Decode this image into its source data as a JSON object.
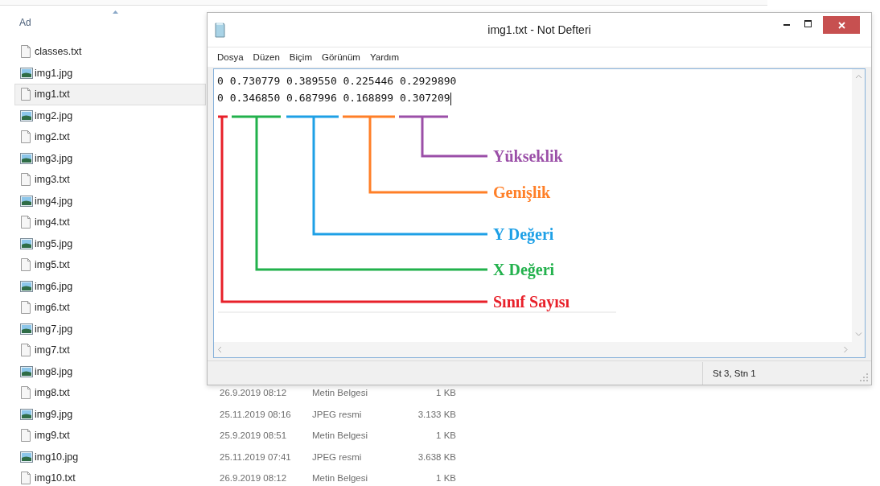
{
  "explorer": {
    "columns": [
      "Ad"
    ],
    "files": [
      {
        "name": "classes.txt",
        "kind": "text",
        "selected": false
      },
      {
        "name": "img1.jpg",
        "kind": "image",
        "selected": false
      },
      {
        "name": "img1.txt",
        "kind": "text",
        "selected": true
      },
      {
        "name": "img2.jpg",
        "kind": "image",
        "selected": false
      },
      {
        "name": "img2.txt",
        "kind": "text",
        "selected": false
      },
      {
        "name": "img3.jpg",
        "kind": "image",
        "selected": false
      },
      {
        "name": "img3.txt",
        "kind": "text",
        "selected": false
      },
      {
        "name": "img4.jpg",
        "kind": "image",
        "selected": false
      },
      {
        "name": "img4.txt",
        "kind": "text",
        "selected": false
      },
      {
        "name": "img5.jpg",
        "kind": "image",
        "selected": false
      },
      {
        "name": "img5.txt",
        "kind": "text",
        "selected": false
      },
      {
        "name": "img6.jpg",
        "kind": "image",
        "selected": false
      },
      {
        "name": "img6.txt",
        "kind": "text",
        "selected": false
      },
      {
        "name": "img7.jpg",
        "kind": "image",
        "selected": false
      },
      {
        "name": "img7.txt",
        "kind": "text",
        "selected": false
      },
      {
        "name": "img8.jpg",
        "kind": "image",
        "selected": false
      },
      {
        "name": "img8.txt",
        "kind": "text",
        "selected": false,
        "date": "26.9.2019 08:12",
        "type": "Metin Belgesi",
        "size": "1 KB"
      },
      {
        "name": "img9.jpg",
        "kind": "image",
        "selected": false,
        "date": "25.11.2019 08:16",
        "type": "JPEG resmi",
        "size": "3.133 KB"
      },
      {
        "name": "img9.txt",
        "kind": "text",
        "selected": false,
        "date": "25.9.2019 08:51",
        "type": "Metin Belgesi",
        "size": "1 KB"
      },
      {
        "name": "img10.jpg",
        "kind": "image",
        "selected": false,
        "date": "25.11.2019 07:41",
        "type": "JPEG resmi",
        "size": "3.638 KB"
      },
      {
        "name": "img10.txt",
        "kind": "text",
        "selected": false,
        "date": "26.9.2019 08:12",
        "type": "Metin Belgesi",
        "size": "1 KB"
      }
    ]
  },
  "notepad": {
    "title": "img1.txt - Not Defteri",
    "menu": [
      "Dosya",
      "Düzen",
      "Biçim",
      "Görünüm",
      "Yardım"
    ],
    "lines": [
      "0 0.730779 0.389550 0.225446 0.2929890",
      "0 0.346850 0.687996 0.168899 0.307209"
    ],
    "annotations": [
      {
        "label": "Yükseklik",
        "color": "#9b4fa8"
      },
      {
        "label": "Genişlik",
        "color": "#ff7f27"
      },
      {
        "label": "Y Değeri",
        "color": "#1ea0e6"
      },
      {
        "label": "X Değeri",
        "color": "#22b14c"
      },
      {
        "label": "Sınıf Sayısı",
        "color": "#e8202a"
      }
    ],
    "status": "St 3, Stn 1"
  }
}
